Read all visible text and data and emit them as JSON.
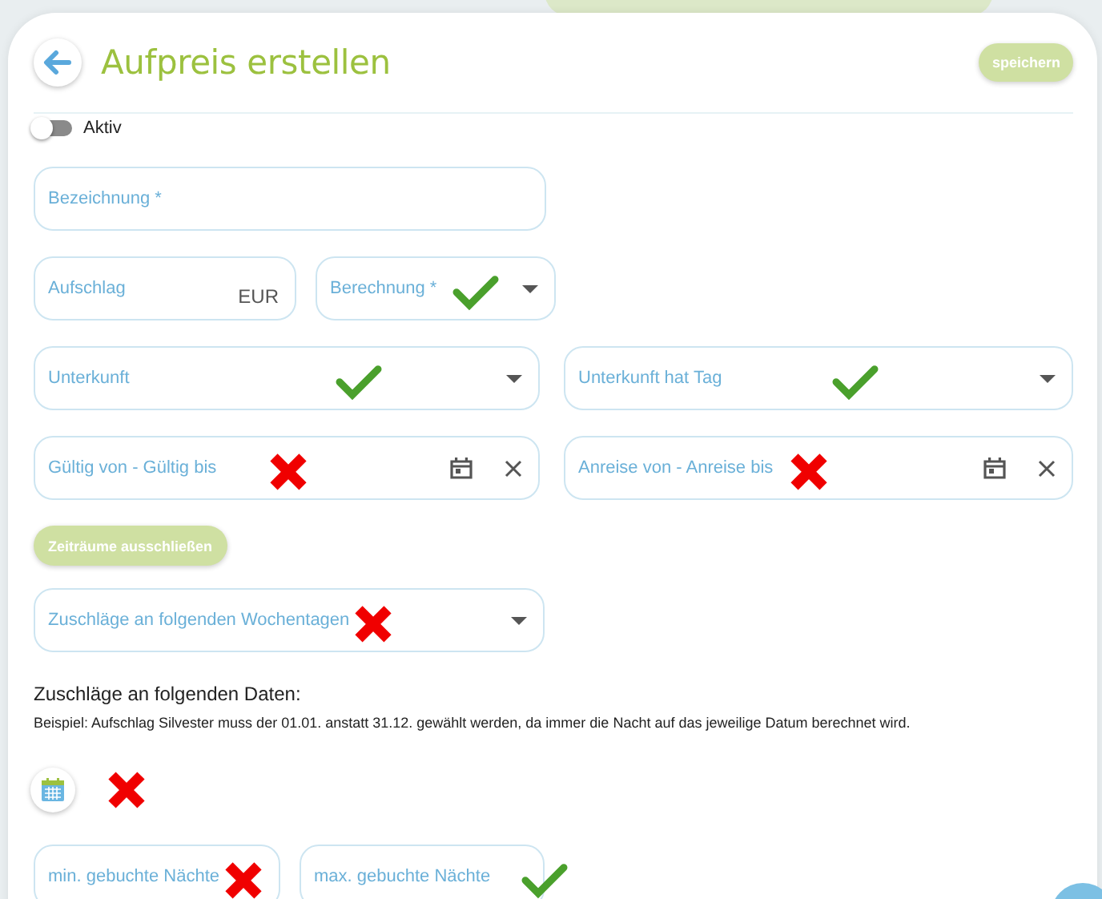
{
  "header": {
    "title": "Aufpreis erstellen",
    "save_button": "speichern"
  },
  "toggle": {
    "label": "Aktiv",
    "on": false
  },
  "field_rows": [
    [
      {
        "label": "Bezeichnung *"
      }
    ],
    [
      {
        "label": "Aufschlag",
        "kind": "currency",
        "unit": "EUR"
      },
      {
        "label": "Berechnung *",
        "kind": "select",
        "check_mark": true
      }
    ],
    [
      {
        "label": "Unterkunft",
        "kind": "select",
        "check_mark": true
      },
      {
        "label": "Unterkunft hat Tag",
        "kind": "select",
        "check_mark": true
      }
    ],
    [
      {
        "label": "Gültig von - Gültig bis",
        "kind": "daterange",
        "cross_mark": true
      },
      {
        "label": "Anreise von - Anreise bis",
        "kind": "daterange",
        "cross_mark": true
      }
    ]
  ],
  "exclude_button": "Zeiträume ausschließen",
  "weekday_field": {
    "label": "Zuschläge an folgenden Wochentagen",
    "kind": "select",
    "cross_mark": true
  },
  "dates_section": {
    "heading": "Zuschläge an folgenden Daten:",
    "note": "Beispiel: Aufschlag Silvester muss der 01.01. anstatt 31.12. gewählt werden, da immer die Nacht auf das jeweilige Datum berechnet wird.",
    "cross_mark": true
  },
  "nights_row": [
    {
      "label": "min. gebuchte Nächte",
      "cross_mark": true
    },
    {
      "label": "max. gebuchte Nächte",
      "check_mark": true
    }
  ]
}
